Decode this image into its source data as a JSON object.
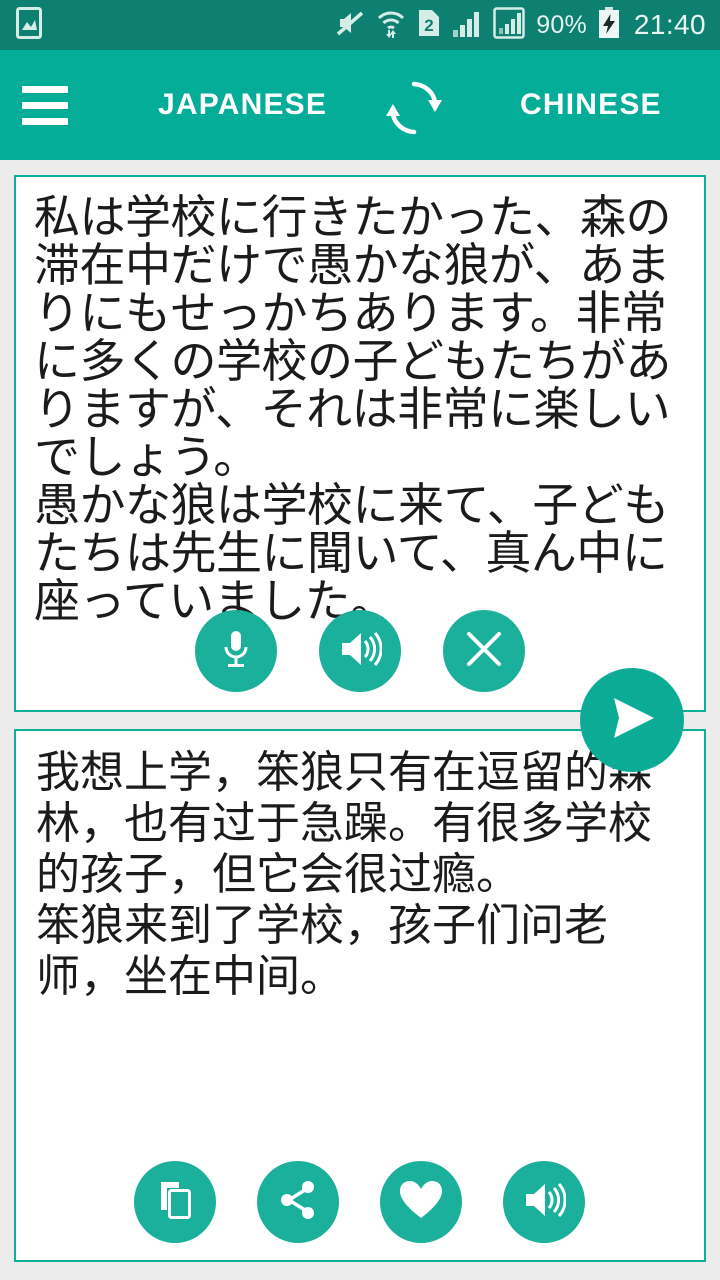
{
  "status_bar": {
    "icons": [
      "image-icon",
      "mute-icon",
      "wifi-icon",
      "sim2-icon",
      "signal-bars-icon",
      "signal-boxed-icon"
    ],
    "battery_percent": "90%",
    "battery_state": "charging",
    "time": "21:40"
  },
  "app_bar": {
    "menu_icon": "hamburger-menu-icon",
    "source_language": "JAPANESE",
    "swap_icon": "swap-languages-icon",
    "target_language": "CHINESE"
  },
  "source_card": {
    "text": "私は学校に行きたかった、森の滞在中だけで愚かな狼が、あまりにもせっかちあります。非常に多くの学校の子どもたちがありますが、それは非常に楽しいでしょう。\n愚かな狼は学校に来て、子どもたちは先生に聞いて、真ん中に座っていました。",
    "actions": [
      {
        "name": "microphone-button",
        "icon": "microphone-icon"
      },
      {
        "name": "speak-source-button",
        "icon": "speaker-icon"
      },
      {
        "name": "clear-button",
        "icon": "close-icon"
      }
    ]
  },
  "send_button": {
    "name": "send-translate-button",
    "icon": "send-icon"
  },
  "target_card": {
    "text": "我想上学，笨狼只有在逗留的森林，也有过于急躁。有很多学校的孩子，但它会很过瘾。\n笨狼来到了学校，孩子们问老师，坐在中间。",
    "actions": [
      {
        "name": "copy-button",
        "icon": "copy-icon"
      },
      {
        "name": "share-button",
        "icon": "share-icon"
      },
      {
        "name": "favorite-button",
        "icon": "heart-icon"
      },
      {
        "name": "speak-target-button",
        "icon": "speaker-icon"
      }
    ]
  },
  "colors": {
    "status_bar": "#0d8071",
    "app_bar": "#04ad98",
    "accent": "#1bb09b",
    "card_border": "#0fae99",
    "page_background": "#ececec",
    "card_background": "#ffffff",
    "text": "#1b1b1b"
  }
}
